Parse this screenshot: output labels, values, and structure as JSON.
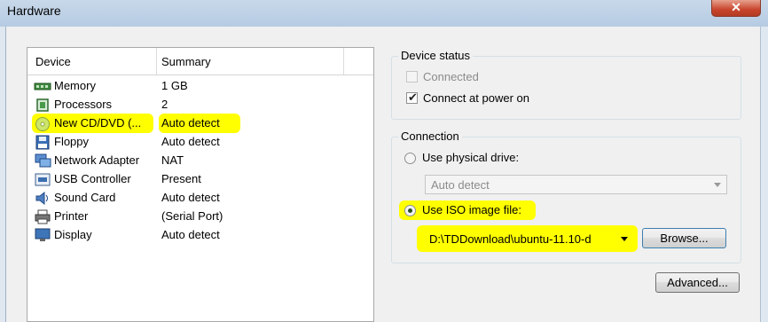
{
  "window": {
    "title": "Hardware",
    "close_label": "✕"
  },
  "device_list": {
    "columns": {
      "device": "Device",
      "summary": "Summary"
    },
    "rows": [
      {
        "name": "Memory",
        "summary": "1 GB",
        "icon": "memory-icon"
      },
      {
        "name": "Processors",
        "summary": "2",
        "icon": "processor-icon"
      },
      {
        "name": "New CD/DVD (...",
        "summary": "Auto detect",
        "icon": "cd-dvd-icon"
      },
      {
        "name": "Floppy",
        "summary": "Auto detect",
        "icon": "floppy-icon"
      },
      {
        "name": "Network Adapter",
        "summary": "NAT",
        "icon": "network-adapter-icon"
      },
      {
        "name": "USB Controller",
        "summary": "Present",
        "icon": "usb-controller-icon"
      },
      {
        "name": "Sound Card",
        "summary": "Auto detect",
        "icon": "sound-card-icon"
      },
      {
        "name": "Printer",
        "summary": "(Serial Port)",
        "icon": "printer-icon"
      },
      {
        "name": "Display",
        "summary": "Auto detect",
        "icon": "display-icon"
      }
    ]
  },
  "device_status": {
    "title": "Device status",
    "connected_label": "Connected",
    "connected_checked": false,
    "connect_power_label": "Connect at power on",
    "connect_power_checked": true
  },
  "connection": {
    "title": "Connection",
    "physical_label": "Use physical drive:",
    "physical_value": "Auto detect",
    "iso_label": "Use ISO image file:",
    "iso_path": "D:\\TDDownload\\ubuntu-11.10-d",
    "browse_label": "Browse...",
    "selected": "iso"
  },
  "advanced_label": "Advanced...",
  "colors": {
    "highlight": "#ffff00",
    "selection": "#e3e3e3",
    "titlebar": "#bfd2e8"
  }
}
